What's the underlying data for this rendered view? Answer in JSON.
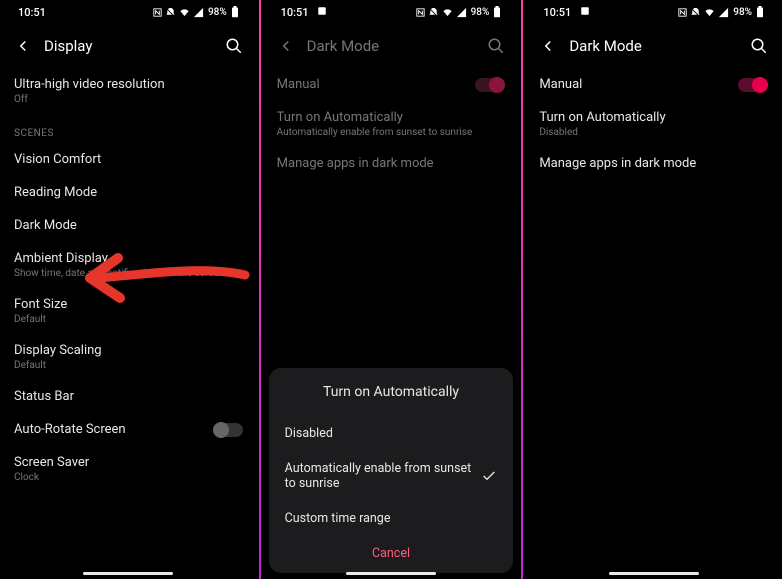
{
  "status": {
    "time": "10:51",
    "battery_pct": "98%",
    "nfc": "N",
    "icons": [
      "nfc",
      "dnd",
      "wifi",
      "signal",
      "battery"
    ]
  },
  "screen1": {
    "title": "Display",
    "items": {
      "ultra": {
        "label": "Ultra-high video resolution",
        "sub": "Off"
      },
      "section_scenes": "SCENES",
      "vision_comfort": "Vision Comfort",
      "reading_mode": "Reading Mode",
      "dark_mode": "Dark Mode",
      "ambient": {
        "label": "Ambient Display",
        "sub": "Show time, date and notifications on the screen"
      },
      "font_size": {
        "label": "Font Size",
        "sub": "Default"
      },
      "display_scaling": {
        "label": "Display Scaling",
        "sub": "Default"
      },
      "status_bar": "Status Bar",
      "auto_rotate": "Auto-Rotate Screen",
      "screen_saver": {
        "label": "Screen Saver",
        "sub": "Clock"
      }
    }
  },
  "screen2": {
    "title": "Dark Mode",
    "manual": "Manual",
    "auto": {
      "label": "Turn on Automatically",
      "sub": "Automatically enable from sunset to sunrise"
    },
    "manage": "Manage apps in dark mode",
    "sheet": {
      "title": "Turn on Automatically",
      "opt_disabled": "Disabled",
      "opt_sunset": "Automatically enable from sunset to sunrise",
      "opt_custom": "Custom time range",
      "cancel": "Cancel"
    }
  },
  "screen3": {
    "title": "Dark Mode",
    "manual": "Manual",
    "auto": {
      "label": "Turn on Automatically",
      "sub": "Disabled"
    },
    "manage": "Manage apps in dark mode"
  }
}
